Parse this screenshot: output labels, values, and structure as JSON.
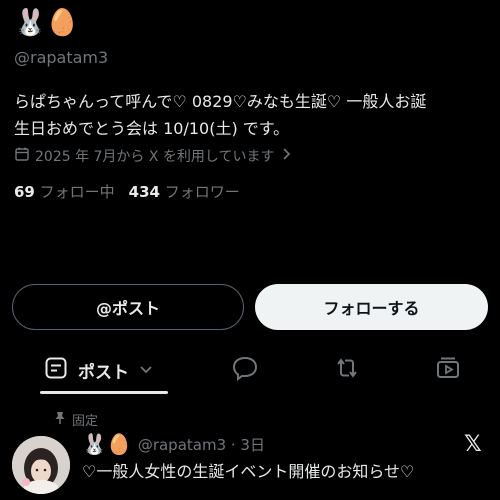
{
  "profile": {
    "display_name": "🐰🥚",
    "handle": "@rapatam3",
    "bio_line1": "らぱちゃんって呼んで♡ 0829♡みなも生誕♡ 一般人お誕",
    "bio_line2": "生日おめでとう会は 10/10(土) です。",
    "joined": "2025 年 7月から X を利用しています",
    "following_count": "69",
    "following_label": "フォロー中",
    "followers_count": "434",
    "followers_label": "フォロワー"
  },
  "actions": {
    "post_label": "@ポスト",
    "follow_label": "フォローする"
  },
  "tabs": {
    "active_label": "ポスト"
  },
  "pinned_tweet": {
    "pinned_label": "固定",
    "author_name": "🐰🥚",
    "meta": "@rapatam3 · 3日",
    "text": "♡一般人女性の生誕イベント開催のお知らせ♡",
    "brand": "𝕏"
  },
  "icons": {
    "calendar": "calendar-icon",
    "chevron_right": "chevron-right-icon",
    "post_tab": "post-tab-icon",
    "chevron_down": "chevron-down-icon",
    "replies": "speech-bubble-icon",
    "reposts": "repost-icon",
    "media": "media-icon",
    "pin": "pin-icon"
  },
  "colors": {
    "background": "#000000",
    "text": "#e7e9ea",
    "muted": "#71767b",
    "follow_button_bg": "#eff3f4"
  }
}
